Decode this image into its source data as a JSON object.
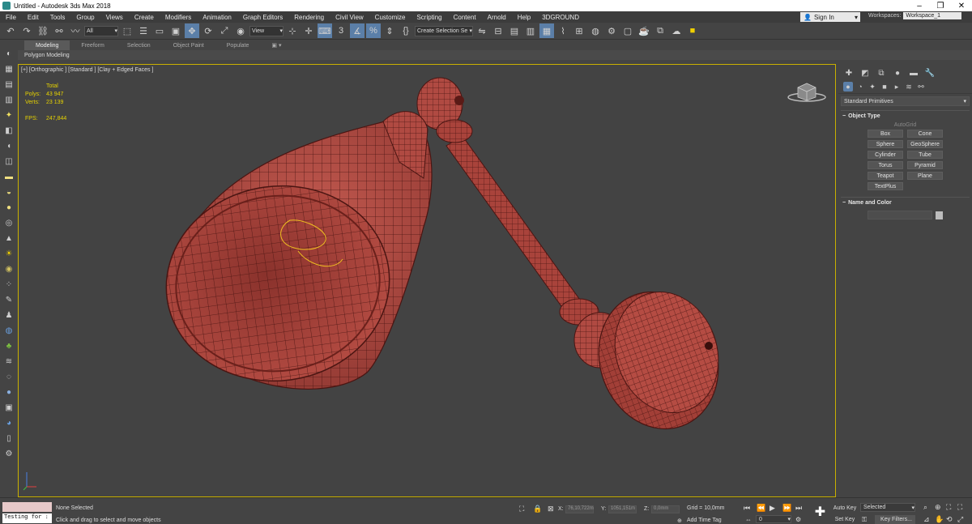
{
  "window": {
    "title": "Untitled - Autodesk 3ds Max 2018"
  },
  "menu": [
    "File",
    "Edit",
    "Tools",
    "Group",
    "Views",
    "Create",
    "Modifiers",
    "Animation",
    "Graph Editors",
    "Rendering",
    "Civil View",
    "Customize",
    "Scripting",
    "Content",
    "Arnold",
    "Help",
    "3DGROUND"
  ],
  "account": {
    "signin": "Sign In",
    "workspaces_label": "Workspaces:",
    "workspace": "Workspace_1"
  },
  "toolbar": {
    "selection_filter": "All",
    "ref_coord": "View",
    "selection_set": "Create Selection Se",
    "snap_value": "3"
  },
  "ribbon": {
    "tabs": [
      "Modeling",
      "Freeform",
      "Selection",
      "Object Paint",
      "Populate"
    ],
    "active": "Modeling",
    "sub": "Polygon Modeling"
  },
  "viewport": {
    "label": "[+] [Orthographic ] [Standard ] [Clay + Edged Faces ]",
    "stats": {
      "header": "Total",
      "polys_label": "Polys:",
      "polys": "43 947",
      "verts_label": "Verts:",
      "verts": "23 139",
      "fps_label": "FPS:",
      "fps": "247,844"
    }
  },
  "command_panel": {
    "category": "Standard Primitives",
    "object_type_title": "Object Type",
    "autogrid": "AutoGrid",
    "primitives": [
      "Box",
      "Cone",
      "Sphere",
      "GeoSphere",
      "Cylinder",
      "Tube",
      "Torus",
      "Pyramid",
      "Teapot",
      "Plane",
      "TextPlus"
    ],
    "name_color_title": "Name and Color"
  },
  "status": {
    "maxscript_input": "Testing for :",
    "selection": "None Selected",
    "prompt": "Click and drag to select and move objects",
    "x_label": "X:",
    "x_value": "76,10,722m",
    "y_label": "Y:",
    "y_value": "1051,151m",
    "z_label": "Z:",
    "z_value": "0,0mm",
    "grid": "Grid = 10,0mm",
    "add_time_tag": "Add Time Tag",
    "auto_key": "Auto Key",
    "set_key": "Set Key",
    "key_mode": "Selected",
    "key_filters": "Key Filters...",
    "frame": "0"
  },
  "colors": {
    "model": "#b04a42",
    "wire": "#4a1512",
    "viewport_border": "#c9b000",
    "stats": "#e6d200",
    "active": "#5b7fa8"
  }
}
